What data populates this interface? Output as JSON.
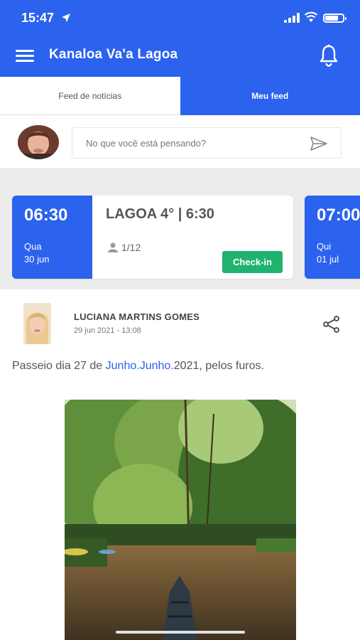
{
  "status_bar": {
    "time": "15:47"
  },
  "app_bar": {
    "title": "Kanaloa Va'a Lagoa"
  },
  "tabs": [
    {
      "label": "Feed de notícias",
      "active": false
    },
    {
      "label": "Meu feed",
      "active": true
    }
  ],
  "composer": {
    "placeholder": "No que você está pensando?"
  },
  "sessions": [
    {
      "time": "06:30",
      "weekday": "Qua",
      "date": "30 jun",
      "title": "LAGOA 4° | 6:30",
      "count": "1/12",
      "action": "Check-in"
    },
    {
      "time": "07:00",
      "weekday": "Qui",
      "date": "01 jul"
    }
  ],
  "post": {
    "author": "LUCIANA MARTINS GOMES",
    "date": "29 jun 2021 - 13:08",
    "text_before": "Passeio dia 27 de ",
    "link_1": "Junho.",
    "link_2": "Junho.",
    "text_after": "2021, pelos furos."
  },
  "colors": {
    "primary": "#2b62ee",
    "checkin": "#1fb36f"
  }
}
